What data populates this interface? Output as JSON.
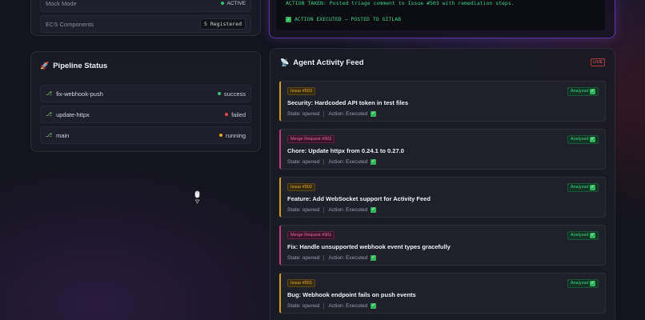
{
  "system": {
    "rows": [
      {
        "label": "Mock Mode",
        "value": "ACTIVE"
      },
      {
        "label": "ECS Components",
        "value": "5 Registered"
      }
    ]
  },
  "pipeline": {
    "title": "Pipeline Status",
    "items": [
      {
        "branch": "fix-webhook-push",
        "status": "success",
        "color": "#3dbf7a"
      },
      {
        "branch": "update-httpx",
        "status": "failed",
        "color": "#e24848"
      },
      {
        "branch": "main",
        "status": "running",
        "color": "#f0a020"
      }
    ]
  },
  "terminal": {
    "line1": "ACTION TAKEN: Posted triage comment to Issue #503 with remediation steps.",
    "line2": "ACTION EXECUTED — POSTED TO GITLAB"
  },
  "feed": {
    "title": "Agent Activity Feed",
    "live": "LIVE",
    "cards": [
      {
        "tag": "Issue #503",
        "kind": "issue",
        "badge": "Analyzed",
        "title": "Security: Hardcoded API token in test files",
        "state": "State: opened",
        "action": "Action: Executed"
      },
      {
        "tag": "Merge Request #902",
        "kind": "mr",
        "badge": "Analyzed",
        "title": "Chore: Update httpx from 0.24.1 to 0.27.0",
        "state": "State: opened",
        "action": "Action: Executed"
      },
      {
        "tag": "Issue #502",
        "kind": "issue",
        "badge": "Analyzed",
        "title": "Feature: Add WebSocket support for Activity Feed",
        "state": "State: opened",
        "action": "Action: Executed"
      },
      {
        "tag": "Merge Request #901",
        "kind": "mr",
        "badge": "Analyzed",
        "title": "Fix: Handle unsupported webhook event types gracefully",
        "state": "State: opened",
        "action": "Action: Executed"
      },
      {
        "tag": "Issue #501",
        "kind": "issue",
        "badge": "Analyzed",
        "title": "Bug: Webhook endpoint fails on push events",
        "state": "State: opened",
        "action": "Action: Executed"
      }
    ]
  },
  "colors": {
    "accent": "#5b3aa8",
    "success": "#3dbf7a",
    "failed": "#e24848",
    "running": "#f0a020"
  }
}
